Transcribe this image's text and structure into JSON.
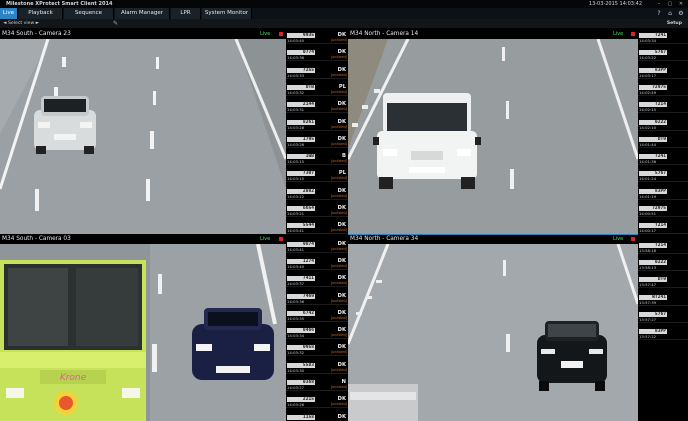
{
  "window": {
    "title": "Milestone XProtect Smart Client 2014",
    "datetime": "13-03-2015 14:03:42",
    "controls": {
      "minimize": "–",
      "restore": "▢",
      "close": "✕"
    }
  },
  "tabs": [
    {
      "label": "Live",
      "active": true
    },
    {
      "label": "Playback",
      "active": false
    },
    {
      "label": "Sequence Explorer",
      "active": false
    },
    {
      "label": "Alarm Manager",
      "active": false
    },
    {
      "label": "LPR",
      "active": false
    },
    {
      "label": "System Monitor",
      "active": false
    }
  ],
  "tab_icons": {
    "help": "?",
    "home": "⌂",
    "settings": "⚙"
  },
  "toolbar": {
    "select_view": "◄ Select view ►",
    "tool_glyph": "✎",
    "setup": "Setup"
  },
  "live_label": "Live",
  "cameras": [
    {
      "name": "M34 South - Camera 23"
    },
    {
      "name": "M34 North - Camera 14"
    },
    {
      "name": "M34 South - Camera 03"
    },
    {
      "name": "M34 North - Camera 34"
    }
  ],
  "lpr_left": [
    {
      "plate": "9935",
      "country": "DK",
      "time": "14:03:40",
      "status": "[unlisted]"
    },
    {
      "plate": "0774",
      "country": "DK",
      "time": "14:03:36",
      "status": "[unlisted]"
    },
    {
      "plate": "7255",
      "country": "DK",
      "time": "14:03:33",
      "status": "[unlisted]"
    },
    {
      "plate": "OTB",
      "country": "PL",
      "time": "14:03:32",
      "status": "[unlisted]"
    },
    {
      "plate": "2144",
      "country": "DK",
      "time": "14:03:31",
      "status": "[unlisted]"
    },
    {
      "plate": "8261",
      "country": "DK",
      "time": "14:03:28",
      "status": "[unlisted]"
    },
    {
      "plate": "1795",
      "country": "DK",
      "time": "14:03:26",
      "status": "[unlisted]"
    },
    {
      "plate": "IWB",
      "country": "B",
      "time": "14:03:15",
      "status": "[unlisted]"
    },
    {
      "plate": "7307",
      "country": "PL",
      "time": "14:03:15",
      "status": "[unlisted]"
    },
    {
      "plate": "2082",
      "country": "DK",
      "time": "14:03:22",
      "status": "[unlisted]"
    },
    {
      "plate": "6654",
      "country": "DK",
      "time": "14:03:21",
      "status": "[unlisted]"
    },
    {
      "plate": "5544",
      "country": "DK",
      "time": "14:03:41",
      "status": "[unlisted]"
    },
    {
      "plate": "9874",
      "country": "DK",
      "time": "14:03:41",
      "status": "[unlisted]"
    },
    {
      "plate": "1274",
      "country": "DK",
      "time": "14:03:40",
      "status": "[unlisted]"
    },
    {
      "plate": "7411",
      "country": "DK",
      "time": "14:03:37",
      "status": "[unlisted]"
    },
    {
      "plate": "7469",
      "country": "DK",
      "time": "14:03:36",
      "status": "[unlisted]"
    },
    {
      "plate": "6742",
      "country": "DK",
      "time": "14:03:35",
      "status": "[unlisted]"
    },
    {
      "plate": "0466",
      "country": "DK",
      "time": "14:03:34",
      "status": "[unlisted]"
    },
    {
      "plate": "0958",
      "country": "DK",
      "time": "14:03:32",
      "status": "[unlisted]"
    },
    {
      "plate": "5583",
      "country": "DK",
      "time": "14:03:30",
      "status": "[unlisted]"
    },
    {
      "plate": "0368",
      "country": "N",
      "time": "14:03:27",
      "status": "[unlisted]"
    },
    {
      "plate": "2215",
      "country": "DK",
      "time": "14:03:26",
      "status": "[unlisted]"
    },
    {
      "plate": "1158",
      "country": "DK",
      "time": "14:03:23",
      "status": "[unlisted]"
    }
  ],
  "lpr_right": [
    {
      "plate": "T241",
      "country": "",
      "time": "14:03:34",
      "status": ""
    },
    {
      "plate": "5767",
      "country": "",
      "time": "14:03:22",
      "status": ""
    },
    {
      "plate": "83PP",
      "country": "",
      "time": "14:03:17",
      "status": ""
    },
    {
      "plate": "72975",
      "country": "",
      "time": "14:02:49",
      "status": ""
    },
    {
      "plate": "T214",
      "country": "",
      "time": "14:02:15",
      "status": ""
    },
    {
      "plate": "0222",
      "country": "",
      "time": "14:02:10",
      "status": ""
    },
    {
      "plate": "DT9",
      "country": "",
      "time": "14:01:44",
      "status": ""
    },
    {
      "plate": "T241",
      "country": "",
      "time": "14:01:36",
      "status": ""
    },
    {
      "plate": "5767",
      "country": "",
      "time": "14:01:24",
      "status": ""
    },
    {
      "plate": "83PP",
      "country": "",
      "time": "14:01:19",
      "status": ""
    },
    {
      "plate": "72975",
      "country": "",
      "time": "14:00:51",
      "status": ""
    },
    {
      "plate": "T214",
      "country": "",
      "time": "14:00:17",
      "status": ""
    },
    {
      "plate": "T214",
      "country": "",
      "time": "13:58:18",
      "status": ""
    },
    {
      "plate": "0222",
      "country": "",
      "time": "13:58:13",
      "status": ""
    },
    {
      "plate": "DT9",
      "country": "",
      "time": "13:57:47",
      "status": ""
    },
    {
      "plate": "WT241",
      "country": "",
      "time": "13:57:39",
      "status": ""
    },
    {
      "plate": "5767",
      "country": "",
      "time": "13:57:27",
      "status": ""
    },
    {
      "plate": "83PP",
      "country": "",
      "time": "13:57:22",
      "status": ""
    }
  ],
  "bus_lettering": "Krone",
  "plate_front_van": "",
  "colors": {
    "accent": "#2c83c6",
    "live": "#41e05a",
    "rec": "#e02222",
    "status": "#cf6a1e"
  }
}
